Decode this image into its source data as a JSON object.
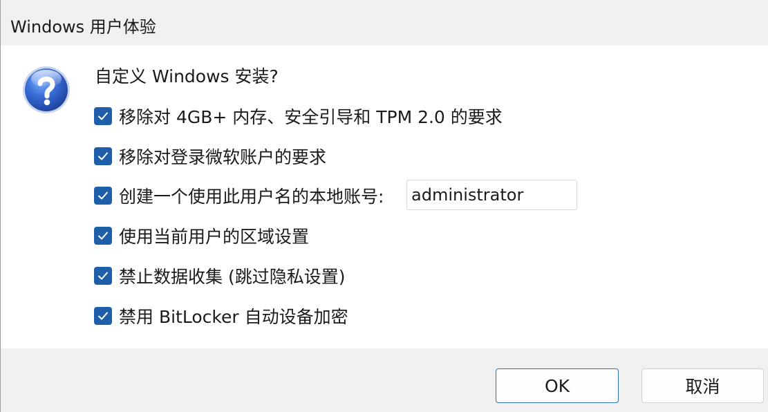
{
  "window": {
    "title": "Windows 用户体验"
  },
  "dialog": {
    "icon": "question-icon",
    "prompt": "自定义 Windows 安装?",
    "options": [
      {
        "label": "移除对 4GB+ 内存、安全引导和 TPM 2.0 的要求",
        "checked": true
      },
      {
        "label": "移除对登录微软账户的要求",
        "checked": true
      },
      {
        "label": "创建一个使用此用户名的本地账号:",
        "checked": true
      },
      {
        "label": "使用当前用户的区域设置",
        "checked": true
      },
      {
        "label": "禁止数据收集 (跳过隐私设置)",
        "checked": true
      },
      {
        "label": "禁用 BitLocker 自动设备加密",
        "checked": true
      }
    ],
    "username": {
      "value": "administrator"
    }
  },
  "buttons": {
    "ok_label": "OK",
    "cancel_label": "取消"
  },
  "colors": {
    "checkbox_accent": "#1f5faa",
    "ok_border": "#2d6fc0",
    "title_bg": "#f0f0f0",
    "footer_bg": "#f0f0f0",
    "icon_blue": "#2f63c8"
  }
}
